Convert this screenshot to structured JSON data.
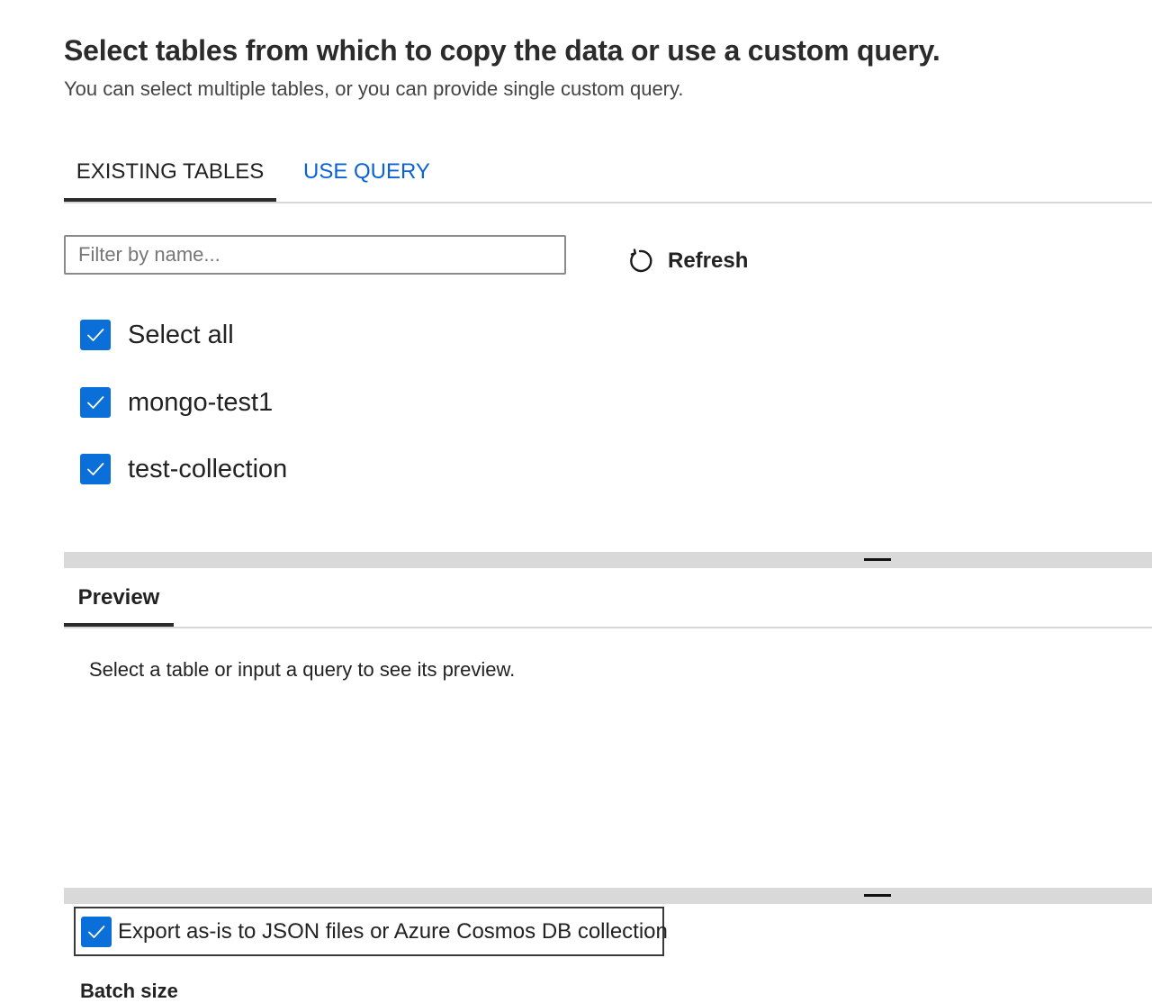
{
  "header": {
    "title": "Select tables from which to copy the data or use a custom query.",
    "subtitle": "You can select multiple tables, or you can provide single custom query."
  },
  "tabs": [
    {
      "label": "EXISTING TABLES",
      "selected": true
    },
    {
      "label": "USE QUERY",
      "selected": false
    }
  ],
  "filter": {
    "placeholder": "Filter by name...",
    "value": ""
  },
  "refresh": {
    "label": "Refresh",
    "icon": "refresh-icon"
  },
  "tables": {
    "select_all": {
      "label": "Select all",
      "checked": true
    },
    "items": [
      {
        "label": "mongo-test1",
        "checked": true
      },
      {
        "label": "test-collection",
        "checked": true
      }
    ]
  },
  "preview": {
    "tab_label": "Preview",
    "message": "Select a table or input a query to see its preview."
  },
  "export": {
    "label": "Export as-is to JSON files or Azure Cosmos DB collection",
    "checked": true
  },
  "batch": {
    "label": "Batch size"
  },
  "colors": {
    "accent": "#0a6fd8",
    "link": "#0a63d6",
    "splitter": "#d9d9d9"
  }
}
